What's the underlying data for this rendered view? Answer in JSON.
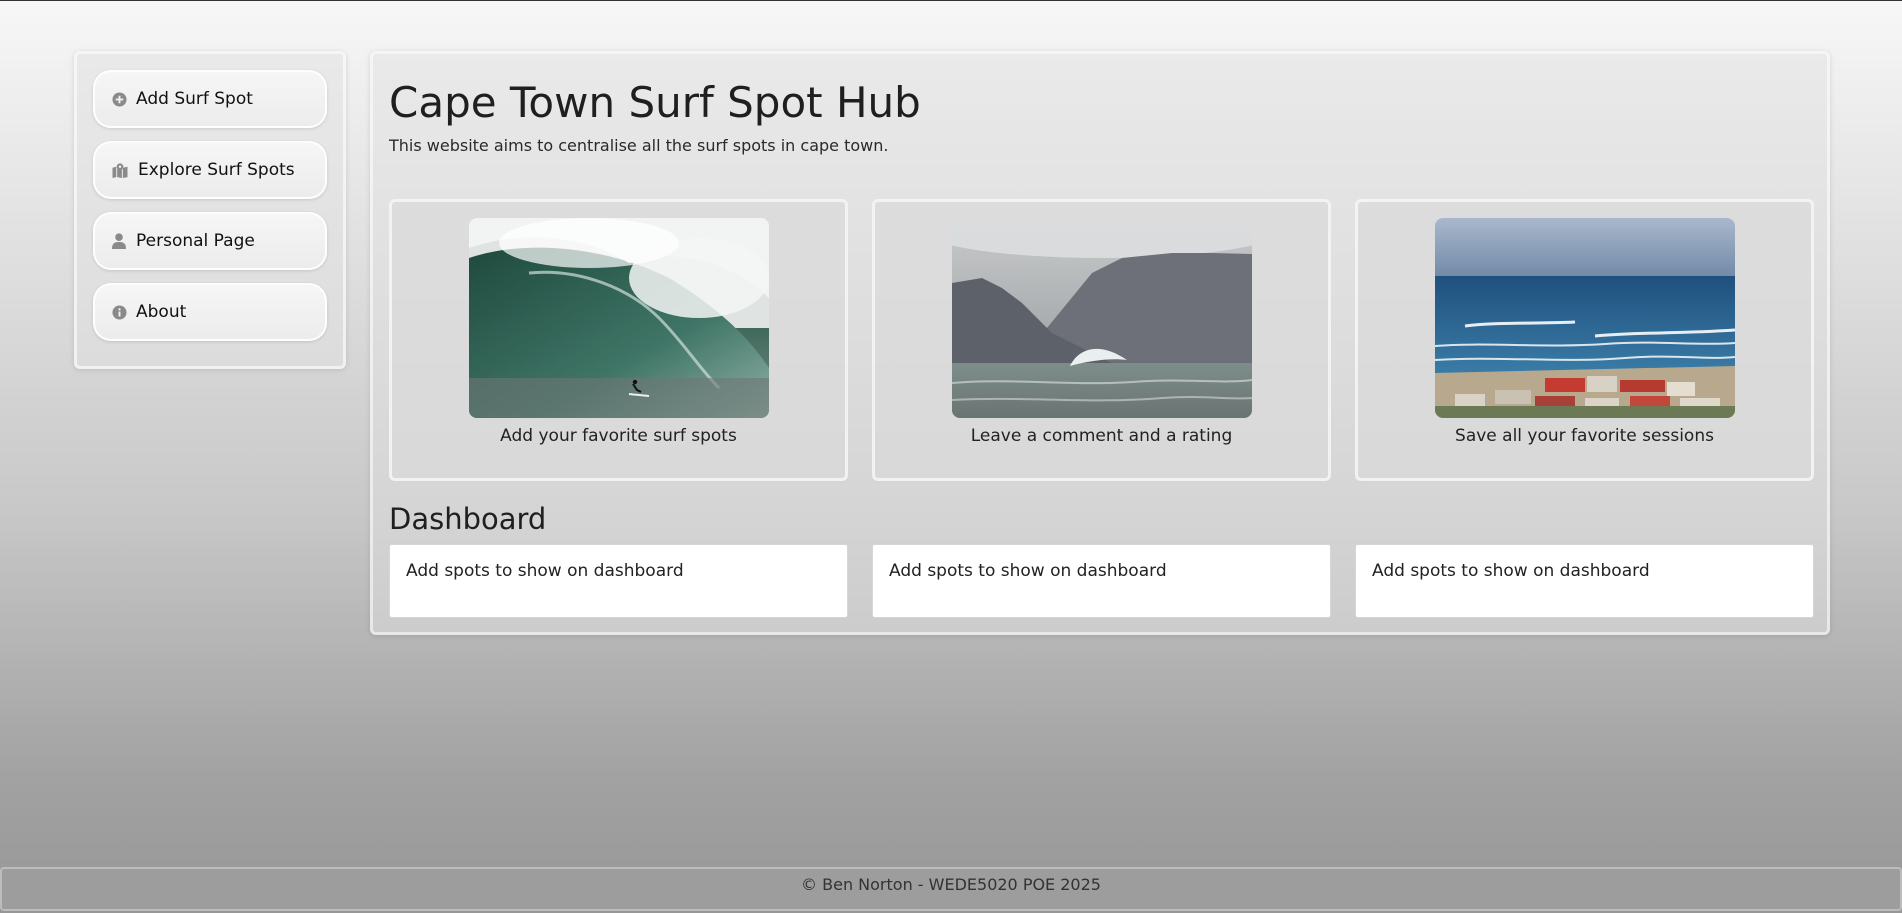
{
  "sidebar": {
    "items": [
      {
        "label": "Add Surf Spot",
        "icon": "plus-circle-icon"
      },
      {
        "label": "Explore Surf Spots",
        "icon": "map-location-icon"
      },
      {
        "label": "Personal Page",
        "icon": "user-icon"
      },
      {
        "label": "About",
        "icon": "info-circle-icon"
      }
    ]
  },
  "main": {
    "title": "Cape Town Surf Spot Hub",
    "subtitle": "This website aims to centralise all the surf spots in cape town.",
    "features": [
      {
        "caption": "Add your favorite surf spots",
        "image": "big-wave-surfer-photo"
      },
      {
        "caption": "Leave a comment and a rating",
        "image": "mountain-wave-photo"
      },
      {
        "caption": "Save all your favorite sessions",
        "image": "coastal-town-photo"
      }
    ],
    "dashboard": {
      "title": "Dashboard",
      "cards": [
        {
          "text": "Add spots to show on dashboard"
        },
        {
          "text": "Add spots to show on dashboard"
        },
        {
          "text": "Add spots to show on dashboard"
        }
      ]
    }
  },
  "footer": {
    "text": "© Ben Norton - WEDE5020 POE 2025"
  },
  "colors": {
    "icon_gray": "#8a8a8a",
    "card_white": "#ffffff"
  }
}
